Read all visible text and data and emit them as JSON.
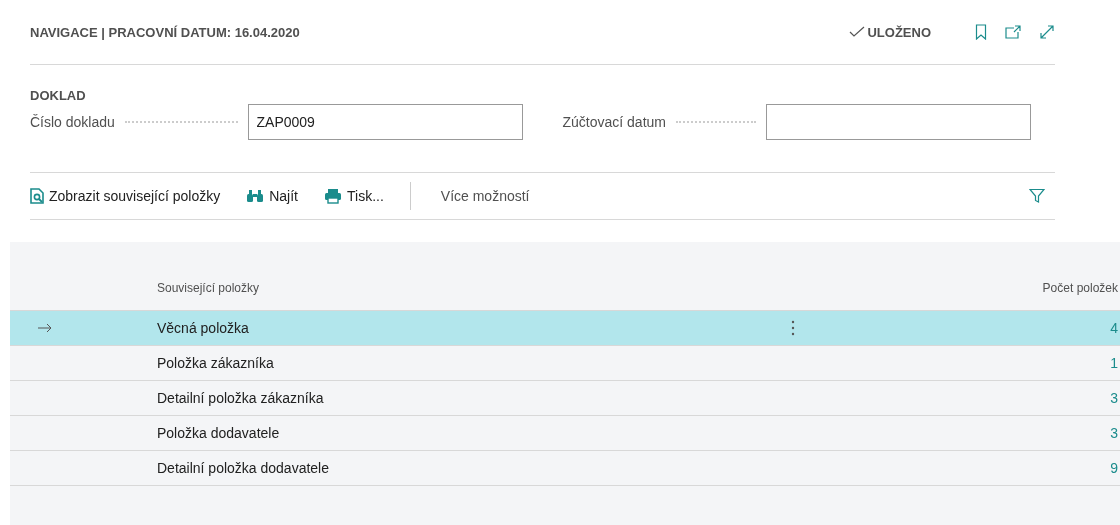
{
  "header": {
    "title": "NAVIGACE | PRACOVNÍ DATUM: 16.04.2020",
    "save_status": "ULOŽENO"
  },
  "section": {
    "title": "DOKLAD",
    "fields": [
      {
        "label": "Číslo dokladu",
        "value": "ZAP0009"
      },
      {
        "label": "Zúčtovací datum"
      }
    ]
  },
  "toolbar": {
    "actions": [
      {
        "kind": "show",
        "label": "Zobrazit související položky"
      },
      {
        "kind": "find",
        "label": "Najít"
      },
      {
        "kind": "print",
        "label": "Tisk..."
      }
    ],
    "more": "Více možností"
  },
  "table": {
    "columns": [
      "Související položky",
      "Počet položek"
    ],
    "rows": [
      {
        "name": "Věcná položka",
        "count": "4",
        "selected": true
      },
      {
        "name": "Položka zákazníka",
        "count": "1",
        "selected": false
      },
      {
        "name": "Detailní položka zákazníka",
        "count": "3",
        "selected": false
      },
      {
        "name": "Položka dodavatele",
        "count": "3",
        "selected": false
      },
      {
        "name": "Detailní položka dodavatele",
        "count": "9",
        "selected": false
      }
    ]
  }
}
